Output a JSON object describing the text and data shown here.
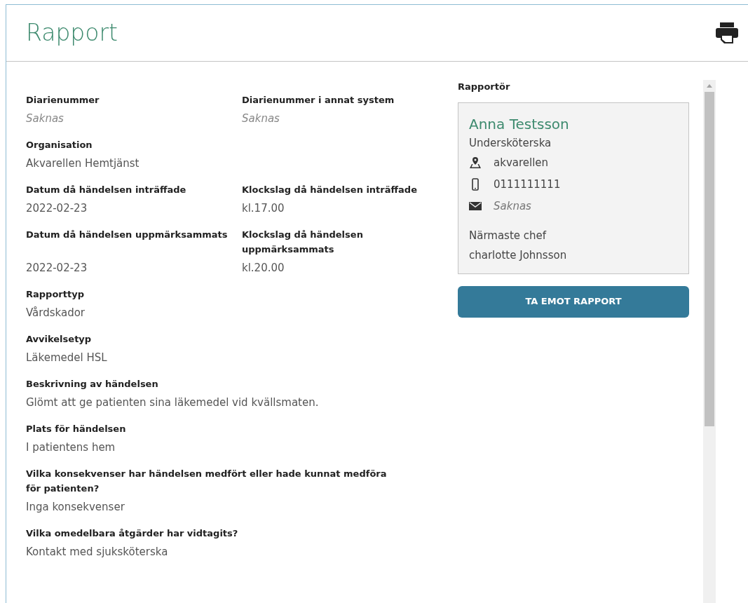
{
  "title": "Rapport",
  "rows": [
    [
      {
        "label": "Diarienummer",
        "value": "Saknas",
        "missing": true
      },
      {
        "label": "Diarienummer i annat system",
        "value": "Saknas",
        "missing": true
      }
    ],
    [
      {
        "label": "Organisation",
        "value": "Akvarellen Hemtjänst",
        "missing": false
      }
    ],
    [
      {
        "label": "Datum då händelsen inträffade",
        "value": "2022-02-23",
        "missing": false
      },
      {
        "label": "Klockslag då händelsen inträffade",
        "value": "kl.17.00",
        "missing": false
      }
    ],
    [
      {
        "label": "Datum då händelsen uppmärksammats",
        "value": "2022-02-23",
        "missing": false
      },
      {
        "label": "Klockslag då händelsen uppmärksammats",
        "value": "kl.20.00",
        "missing": false
      }
    ],
    [
      {
        "label": "Rapporttyp",
        "value": "Vårdskador",
        "missing": false
      }
    ],
    [
      {
        "label": "Avvikelsetyp",
        "value": "Läkemedel HSL",
        "missing": false
      }
    ],
    [
      {
        "label": "Beskrivning av händelsen",
        "value": "Glömt att ge patienten sina läkemedel vid kvällsmaten.",
        "missing": false
      }
    ],
    [
      {
        "label": "Plats för händelsen",
        "value": "I patientens hem",
        "missing": false
      }
    ],
    [
      {
        "label": "Vilka konsekvenser har händelsen medfört eller hade kunnat medföra för patienten?",
        "value": "Inga konsekvenser",
        "missing": false
      }
    ],
    [
      {
        "label": "Vilka omedelbara åtgärder har vidtagits?",
        "value": "Kontakt med sjuksköterska",
        "missing": false
      }
    ]
  ],
  "reporter": {
    "heading": "Rapportör",
    "name": "Anna Testsson",
    "role": "Undersköterska",
    "contacts": [
      {
        "kind": "location",
        "value": "akvarellen",
        "missing": false
      },
      {
        "kind": "phone",
        "value": "0111111111",
        "missing": false
      },
      {
        "kind": "email",
        "value": "Saknas",
        "missing": true
      }
    ],
    "manager_label": "Närmaste chef",
    "manager": "charlotte Johnsson"
  },
  "button": "TA EMOT RAPPORT"
}
